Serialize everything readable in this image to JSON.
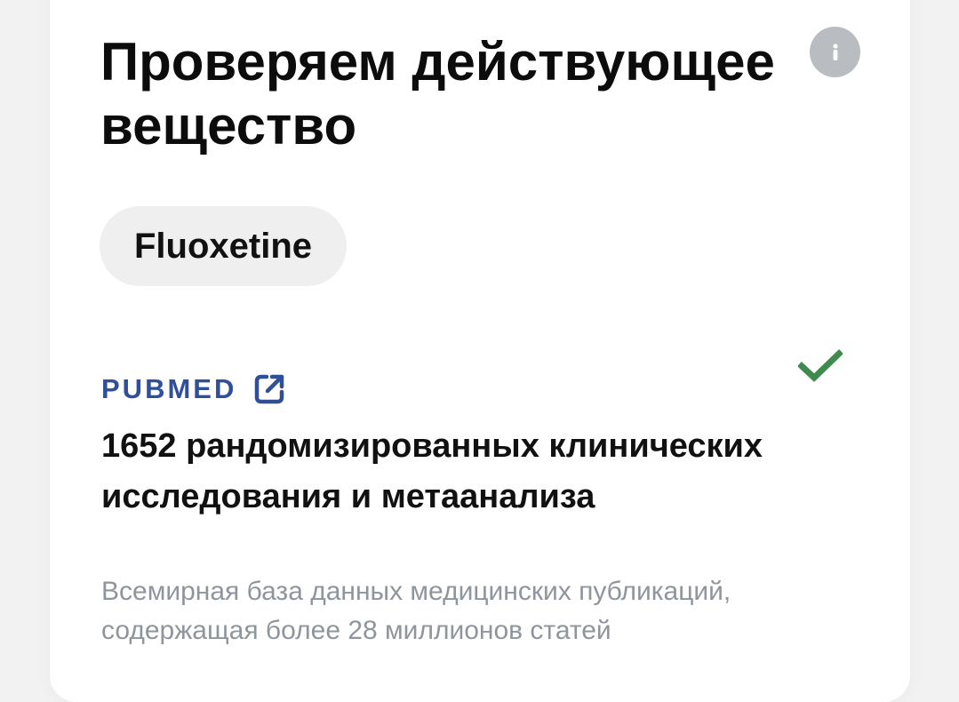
{
  "card": {
    "title": "Проверяем действующее вещество",
    "info_icon": "info-icon",
    "substance_chip": "Fluoxetine",
    "source": {
      "label": "PUBMED",
      "link_icon": "external-link-icon",
      "status_icon": "checkmark-icon",
      "headline": "1652 рандомизированных клинических исследования и метаанализа",
      "description": "Всемирная база данных медицинских публикаций, содержащая более 28 миллионов статей"
    }
  },
  "colors": {
    "background": "#f2f2f3",
    "card": "#ffffff",
    "accent_blue": "#2f4f9b",
    "check_green": "#3f8a4f",
    "info_grey": "#b9bcc1",
    "muted_text": "#8f959d"
  }
}
